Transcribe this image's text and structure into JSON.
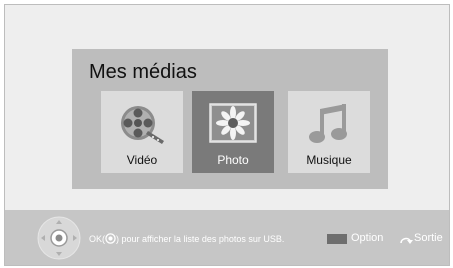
{
  "panel": {
    "title": "Mes médias"
  },
  "tiles": [
    {
      "label": "Vidéo",
      "icon": "film-reel-icon",
      "selected": false
    },
    {
      "label": "Photo",
      "icon": "flower-photo-icon",
      "selected": true
    },
    {
      "label": "Musique",
      "icon": "music-note-icon",
      "selected": false
    }
  ],
  "footer": {
    "hint_prefix": "OK(",
    "hint_suffix": ") pour afficher la liste des photos sur USB.",
    "option_label": "Option",
    "exit_label": "Sortie"
  },
  "colors": {
    "background": "#eeeeee",
    "panel": "#bdbdbd",
    "tile": "#dcdcdc",
    "tile_selected": "#7a7a7a",
    "footer": "#c6c6c6"
  }
}
